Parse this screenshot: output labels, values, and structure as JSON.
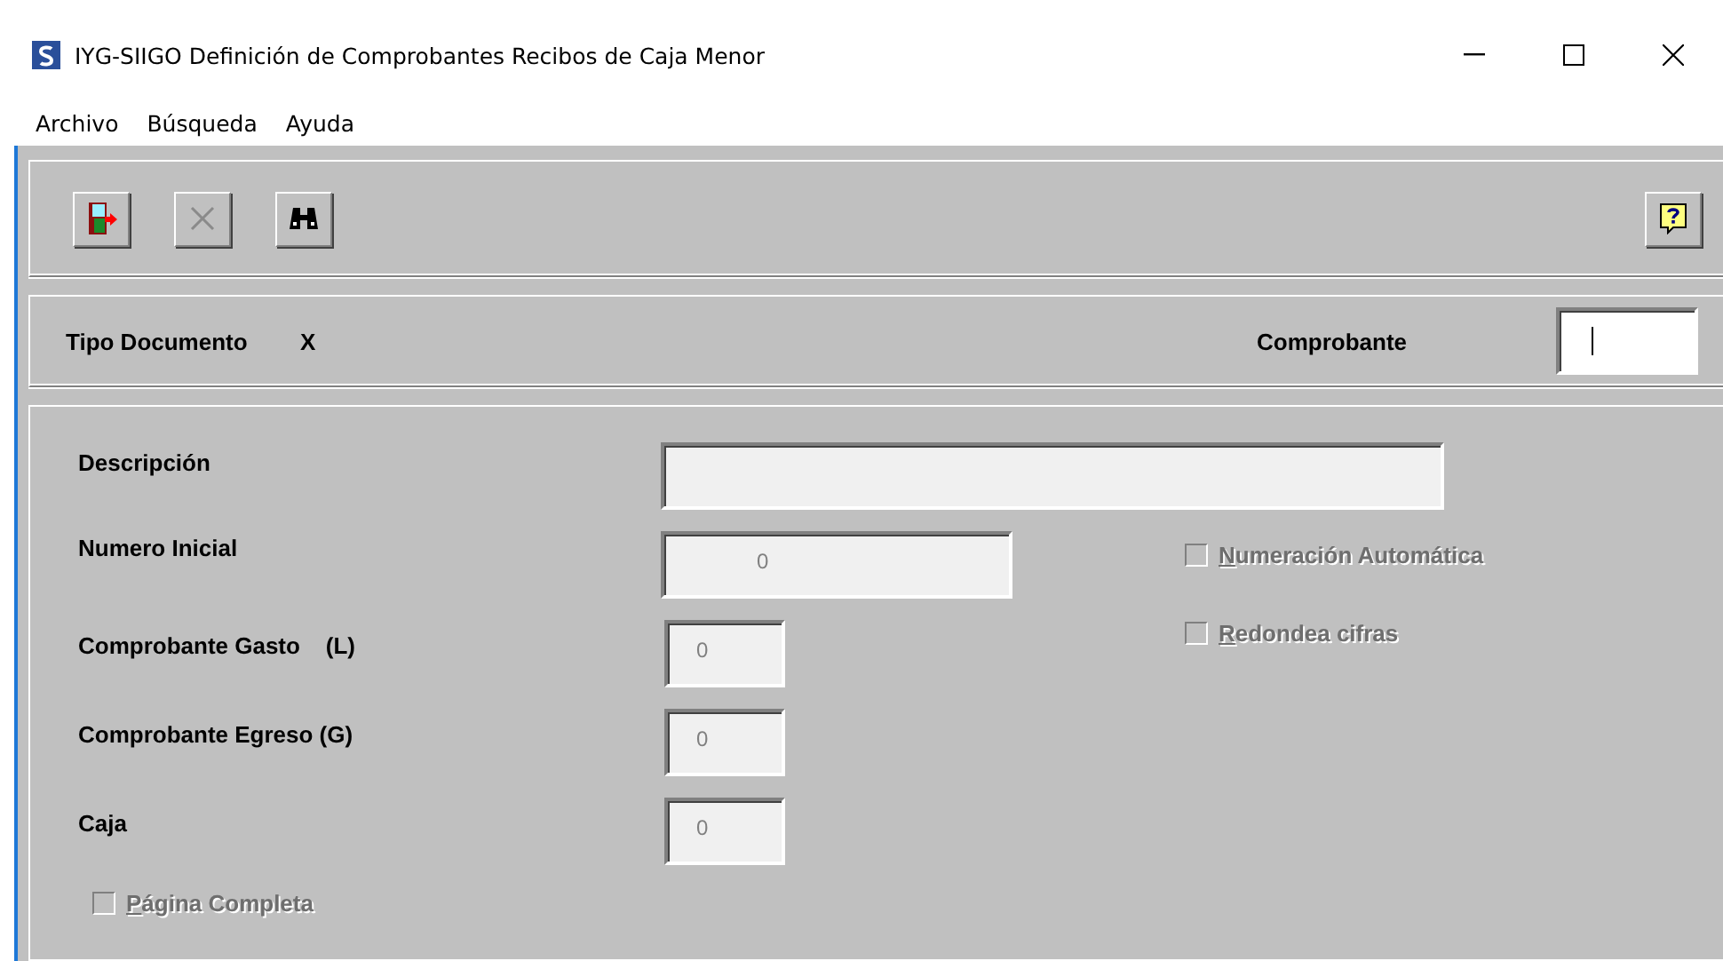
{
  "window": {
    "title": "IYG-SIIGO Definición de Comprobantes Recibos de Caja Menor"
  },
  "menu": [
    "Archivo",
    "Búsqueda",
    "Ayuda"
  ],
  "toolbar": [
    {
      "kind": "exit"
    },
    {
      "kind": "cancel"
    },
    {
      "kind": "search"
    }
  ],
  "header": {
    "tipo_documento_label": "Tipo Documento",
    "tipo_documento_value": "X",
    "comprobante_label": "Comprobante"
  },
  "fields": [
    {
      "label": "Descripción",
      "kind": "wide"
    },
    {
      "label": "Numero Inicial",
      "value": "0",
      "kind": "medium"
    },
    {
      "label": "Comprobante Gasto    (L)",
      "value": "0",
      "kind": "small"
    },
    {
      "label": "Comprobante Egreso (G)",
      "value": "0",
      "kind": "small"
    },
    {
      "label": "Caja",
      "value": "0",
      "kind": "small"
    }
  ],
  "options": [
    {
      "label": "Numeración Automática",
      "checked": false,
      "disabled": true
    },
    {
      "label": "Redondea cifras",
      "checked": false,
      "disabled": true
    }
  ],
  "page_option": {
    "label": "Página Completa",
    "checked": false,
    "disabled": true
  }
}
